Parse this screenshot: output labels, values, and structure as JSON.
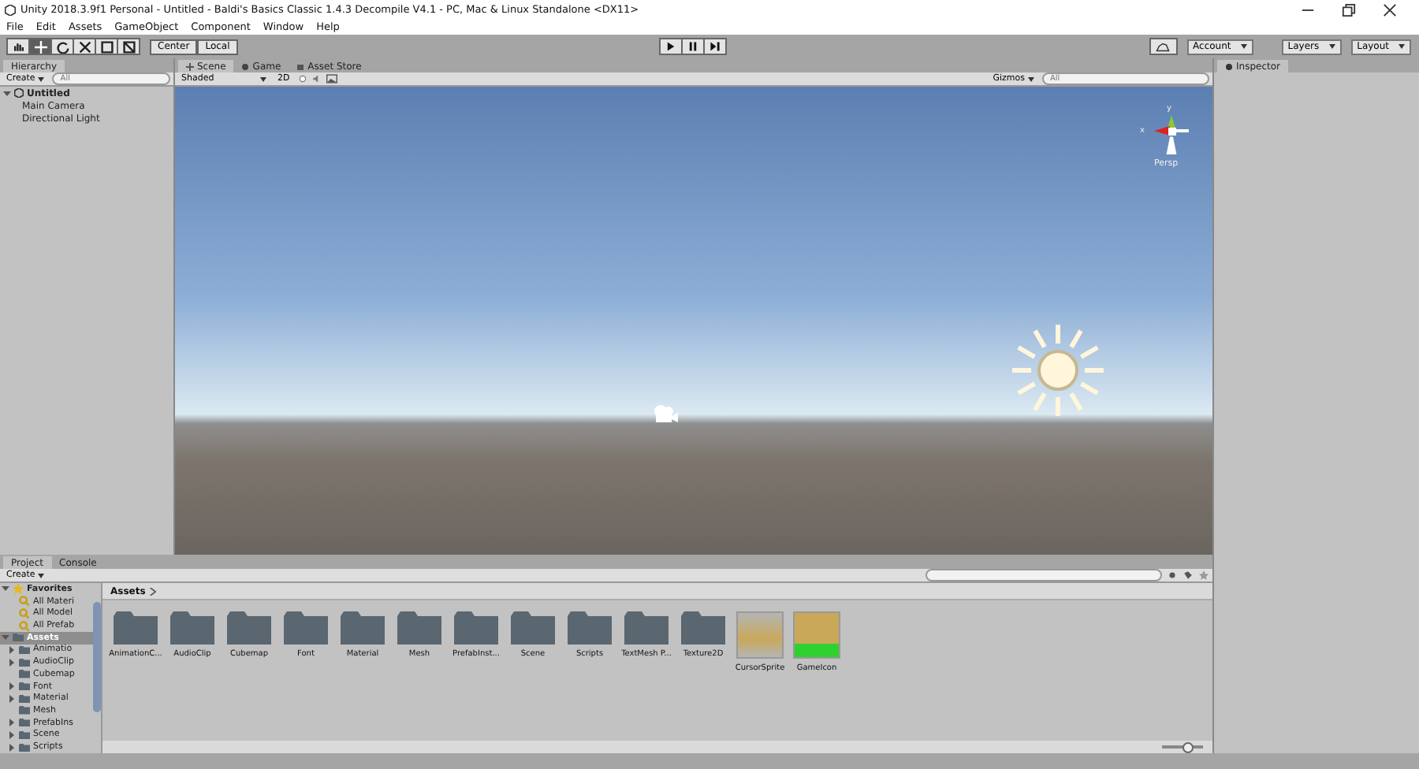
{
  "window": {
    "title": "Unity 2018.3.9f1 Personal - Untitled - Baldi's Basics Classic 1.4.3 Decompile V4.1 - PC, Mac & Linux Standalone <DX11>"
  },
  "menu": [
    "File",
    "Edit",
    "Assets",
    "GameObject",
    "Component",
    "Window",
    "Help"
  ],
  "tools": [
    {
      "kind": "hand",
      "selected": false
    },
    {
      "kind": "move",
      "selected": true
    },
    {
      "kind": "rotate",
      "selected": false
    },
    {
      "kind": "scale",
      "selected": false
    },
    {
      "kind": "rect",
      "selected": false
    },
    {
      "kind": "transform",
      "selected": false
    }
  ],
  "pivot_buttons": [
    "Center",
    "Local"
  ],
  "account": {
    "account": "Account",
    "layers": "Layers",
    "layout": "Layout"
  },
  "hierarchy": {
    "tab": "Hierarchy",
    "create": "Create",
    "search_placeholder": "All",
    "scene": "Untitled",
    "expanded": true,
    "items": [
      "Main Camera",
      "Directional Light"
    ]
  },
  "scene_tabs": [
    {
      "label": "Scene",
      "kind": "scene",
      "selected": true
    },
    {
      "label": "Game",
      "kind": "game",
      "selected": false
    },
    {
      "label": "Asset Store",
      "kind": "store",
      "selected": false
    }
  ],
  "scene_toolbar": {
    "shading": "Shaded",
    "mode_2d": "2D",
    "gizmos": "Gizmos",
    "search_placeholder": "All"
  },
  "scene_gizmo": {
    "y": "y",
    "x": "x",
    "projection": "Persp"
  },
  "inspector": {
    "tab": "Inspector"
  },
  "project_tabs": [
    {
      "label": "Project",
      "selected": true
    },
    {
      "label": "Console",
      "selected": false
    }
  ],
  "project": {
    "create": "Create",
    "breadcrumb": "Assets",
    "tree": [
      {
        "label": "Favorites",
        "kind": "favorites",
        "expanded": true,
        "children": [
          {
            "label": "All Materi"
          },
          {
            "label": "All Model"
          },
          {
            "label": "All Prefab"
          }
        ]
      },
      {
        "label": "Assets",
        "kind": "folder",
        "expanded": true,
        "selected": true,
        "children": [
          {
            "label": "Animatio",
            "expanded": false
          },
          {
            "label": "AudioClip",
            "expanded": false
          },
          {
            "label": "Cubemap"
          },
          {
            "label": "Font",
            "expanded": false
          },
          {
            "label": "Material",
            "expanded": false
          },
          {
            "label": "Mesh"
          },
          {
            "label": "PrefabIns",
            "expanded": false
          },
          {
            "label": "Scene",
            "expanded": false
          },
          {
            "label": "Scripts",
            "expanded": false
          }
        ]
      }
    ],
    "assets": [
      {
        "label": "AnimationC...",
        "kind": "folder"
      },
      {
        "label": "AudioClip",
        "kind": "folder"
      },
      {
        "label": "Cubemap",
        "kind": "folder"
      },
      {
        "label": "Font",
        "kind": "folder"
      },
      {
        "label": "Material",
        "kind": "folder"
      },
      {
        "label": "Mesh",
        "kind": "folder"
      },
      {
        "label": "PrefabInst...",
        "kind": "folder"
      },
      {
        "label": "Scene",
        "kind": "folder"
      },
      {
        "label": "Scripts",
        "kind": "folder"
      },
      {
        "label": "TextMesh P...",
        "kind": "folder"
      },
      {
        "label": "Texture2D",
        "kind": "folder"
      },
      {
        "label": "CursorSprite",
        "kind": "hand"
      },
      {
        "label": "GameIcon",
        "kind": "head"
      }
    ]
  },
  "zoom": {
    "level": 0.6
  }
}
